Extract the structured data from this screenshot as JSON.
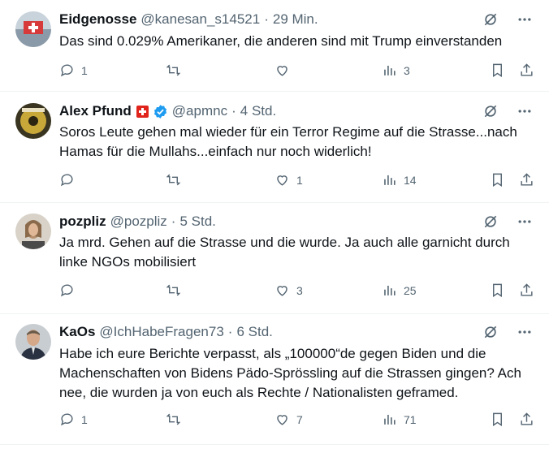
{
  "tweets": [
    {
      "name": "Eidgenosse",
      "handle": "@kanesan_s14521",
      "time": "29 Min.",
      "text": "Das sind 0.029% Amerikaner, die anderen sind mit Trump einverstanden",
      "replies": "1",
      "retweets": "",
      "likes": "",
      "views": "3",
      "has_flag": false,
      "verified": false
    },
    {
      "name": "Alex Pfund",
      "handle": "@apmnc",
      "time": "4 Std.",
      "text": "Soros Leute gehen mal wieder für ein Terror Regime auf die Strasse...nach Hamas für die Mullahs...einfach nur noch widerlich!",
      "replies": "",
      "retweets": "",
      "likes": "1",
      "views": "14",
      "has_flag": true,
      "verified": true
    },
    {
      "name": "pozpliz",
      "handle": "@pozpliz",
      "time": "5 Std.",
      "text": "Ja mrd. Gehen auf die Strasse und die wurde. Ja auch alle garnicht durch linke NGOs mobilisiert",
      "replies": "",
      "retweets": "",
      "likes": "3",
      "views": "25",
      "has_flag": false,
      "verified": false
    },
    {
      "name": "KaOs",
      "handle": "@IchHabeFragen73",
      "time": "6 Std.",
      "text": "Habe ich eure Berichte verpasst, als „100000“de gegen Biden und die Machenschaften von Bidens Pädo-Sprössling auf die Strassen gingen? Ach nee, die wurden ja von euch als Rechte / Nationalisten geframed.",
      "replies": "1",
      "retweets": "",
      "likes": "7",
      "views": "71",
      "has_flag": false,
      "verified": false
    }
  ],
  "separator": "·",
  "colors": {
    "text": "#0f1419",
    "secondary": "#536471",
    "verified": "#1d9bf0",
    "flag": "#e0241b",
    "border": "#eff3f4"
  },
  "icons": [
    "reply-icon",
    "retweet-icon",
    "like-icon",
    "views-icon",
    "bookmark-icon",
    "share-icon",
    "grok-icon",
    "more-icon",
    "verified-badge-icon",
    "swiss-flag-icon"
  ]
}
